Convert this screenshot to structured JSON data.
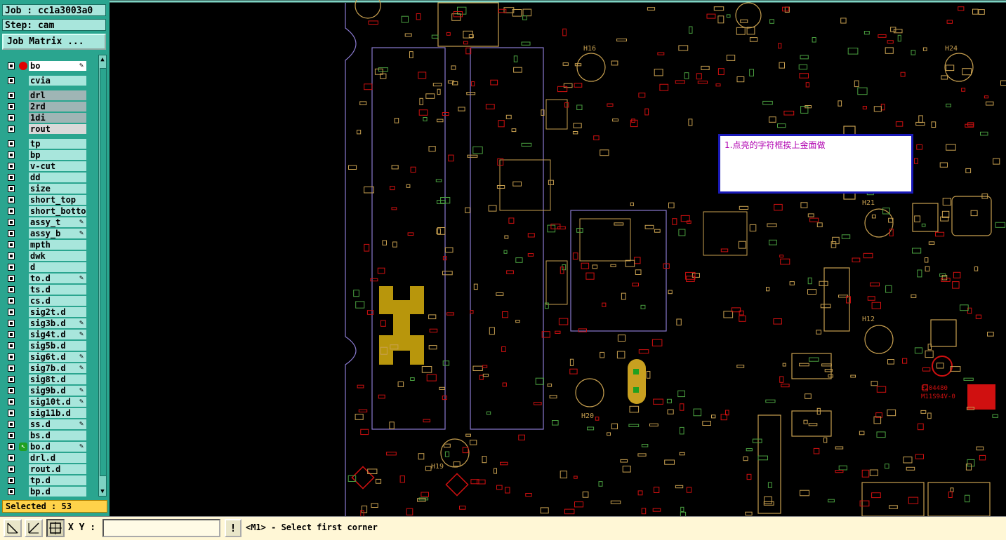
{
  "header": {
    "job_label": "Job : cc1a3003a0",
    "step_label": "Step: cam",
    "job_matrix_button": "Job Matrix ..."
  },
  "layers": [
    {
      "name": "bo",
      "style": "white",
      "marker": "red-dot",
      "pen": true
    },
    {
      "name": "cvia",
      "style": "",
      "marker": "",
      "pen": false
    },
    {
      "name": "drl",
      "style": "grey",
      "marker": "",
      "pen": false
    },
    {
      "name": "2rd",
      "style": "grey",
      "marker": "",
      "pen": false
    },
    {
      "name": "1di",
      "style": "grey",
      "marker": "",
      "pen": false
    },
    {
      "name": "rout",
      "style": "light",
      "marker": "",
      "pen": false
    },
    {
      "name": "tp",
      "style": "",
      "marker": "",
      "pen": false
    },
    {
      "name": "bp",
      "style": "",
      "marker": "",
      "pen": false
    },
    {
      "name": "v-cut",
      "style": "",
      "marker": "",
      "pen": false
    },
    {
      "name": "dd",
      "style": "",
      "marker": "",
      "pen": false
    },
    {
      "name": "size",
      "style": "",
      "marker": "",
      "pen": false
    },
    {
      "name": "short_top",
      "style": "",
      "marker": "",
      "pen": false
    },
    {
      "name": "short_bottom",
      "style": "",
      "marker": "",
      "pen": false
    },
    {
      "name": "assy_t",
      "style": "",
      "marker": "",
      "pen": true
    },
    {
      "name": "assy_b",
      "style": "",
      "marker": "",
      "pen": true
    },
    {
      "name": "mpth",
      "style": "",
      "marker": "",
      "pen": false
    },
    {
      "name": "dwk",
      "style": "",
      "marker": "",
      "pen": false
    },
    {
      "name": "d",
      "style": "",
      "marker": "",
      "pen": false
    },
    {
      "name": "to.d",
      "style": "",
      "marker": "",
      "pen": true
    },
    {
      "name": "ts.d",
      "style": "",
      "marker": "",
      "pen": false
    },
    {
      "name": "cs.d",
      "style": "",
      "marker": "",
      "pen": false
    },
    {
      "name": "sig2t.d",
      "style": "",
      "marker": "",
      "pen": false
    },
    {
      "name": "sig3b.d",
      "style": "",
      "marker": "",
      "pen": true
    },
    {
      "name": "sig4t.d",
      "style": "",
      "marker": "",
      "pen": true
    },
    {
      "name": "sig5b.d",
      "style": "",
      "marker": "",
      "pen": false
    },
    {
      "name": "sig6t.d",
      "style": "",
      "marker": "",
      "pen": true
    },
    {
      "name": "sig7b.d",
      "style": "",
      "marker": "",
      "pen": true
    },
    {
      "name": "sig8t.d",
      "style": "",
      "marker": "",
      "pen": false
    },
    {
      "name": "sig9b.d",
      "style": "",
      "marker": "",
      "pen": true
    },
    {
      "name": "sig10t.d",
      "style": "",
      "marker": "",
      "pen": true
    },
    {
      "name": "sig11b.d",
      "style": "",
      "marker": "",
      "pen": false
    },
    {
      "name": "ss.d",
      "style": "",
      "marker": "",
      "pen": true
    },
    {
      "name": "bs.d",
      "style": "",
      "marker": "",
      "pen": false
    },
    {
      "name": "bo.d",
      "style": "",
      "marker": "green-arrow",
      "pen": true
    },
    {
      "name": "drl.d",
      "style": "",
      "marker": "",
      "pen": false
    },
    {
      "name": "rout.d",
      "style": "",
      "marker": "",
      "pen": false
    },
    {
      "name": "tp.d",
      "style": "",
      "marker": "",
      "pen": false
    },
    {
      "name": "bp.d",
      "style": "",
      "marker": "",
      "pen": false
    }
  ],
  "selected_label": "Selected : 53",
  "status": {
    "xy_label": "X Y :",
    "xy_value": "",
    "bang_label": "!",
    "prompt": "<M1> - Select first corner"
  },
  "note": {
    "text": "1.点亮的字符框挨上金面做"
  },
  "colors": {
    "panel_bg": "#2aa58f",
    "layer_bg": "#a8e6dc",
    "selected_bg": "#ffd24a",
    "pcb_silk": "#c8a050",
    "pcb_red": "#d01010",
    "pcb_outline": "#8a7ad0",
    "note_border": "#1a1ab8",
    "note_text": "#b000b0"
  }
}
